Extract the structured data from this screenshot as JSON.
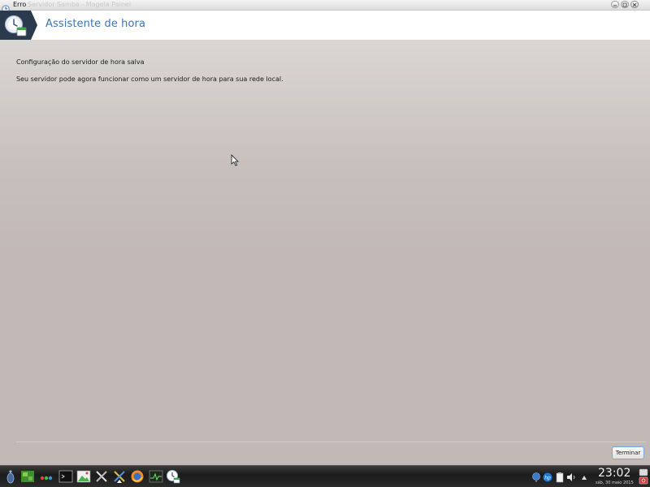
{
  "window": {
    "title": "Erro",
    "ghost_title": "Servidor Samba - Mageia Painel"
  },
  "header": {
    "title": "Assistente de hora"
  },
  "content": {
    "message_1": "Configuração do servidor de hora salva",
    "message_2": "Seu servidor pode agora funcionar como um servidor de hora para sua rede local."
  },
  "footer": {
    "finish_label": "Terminar"
  },
  "taskbar": {
    "clock": "23:02",
    "date": "sáb, 30 maio 2015"
  },
  "colors": {
    "heading": "#3c74b8",
    "header_emblem": "#2c3a4d",
    "content_background": "#c4bab8",
    "button_border": "#7aa7d8",
    "taskbar": "#2a2a2a"
  }
}
